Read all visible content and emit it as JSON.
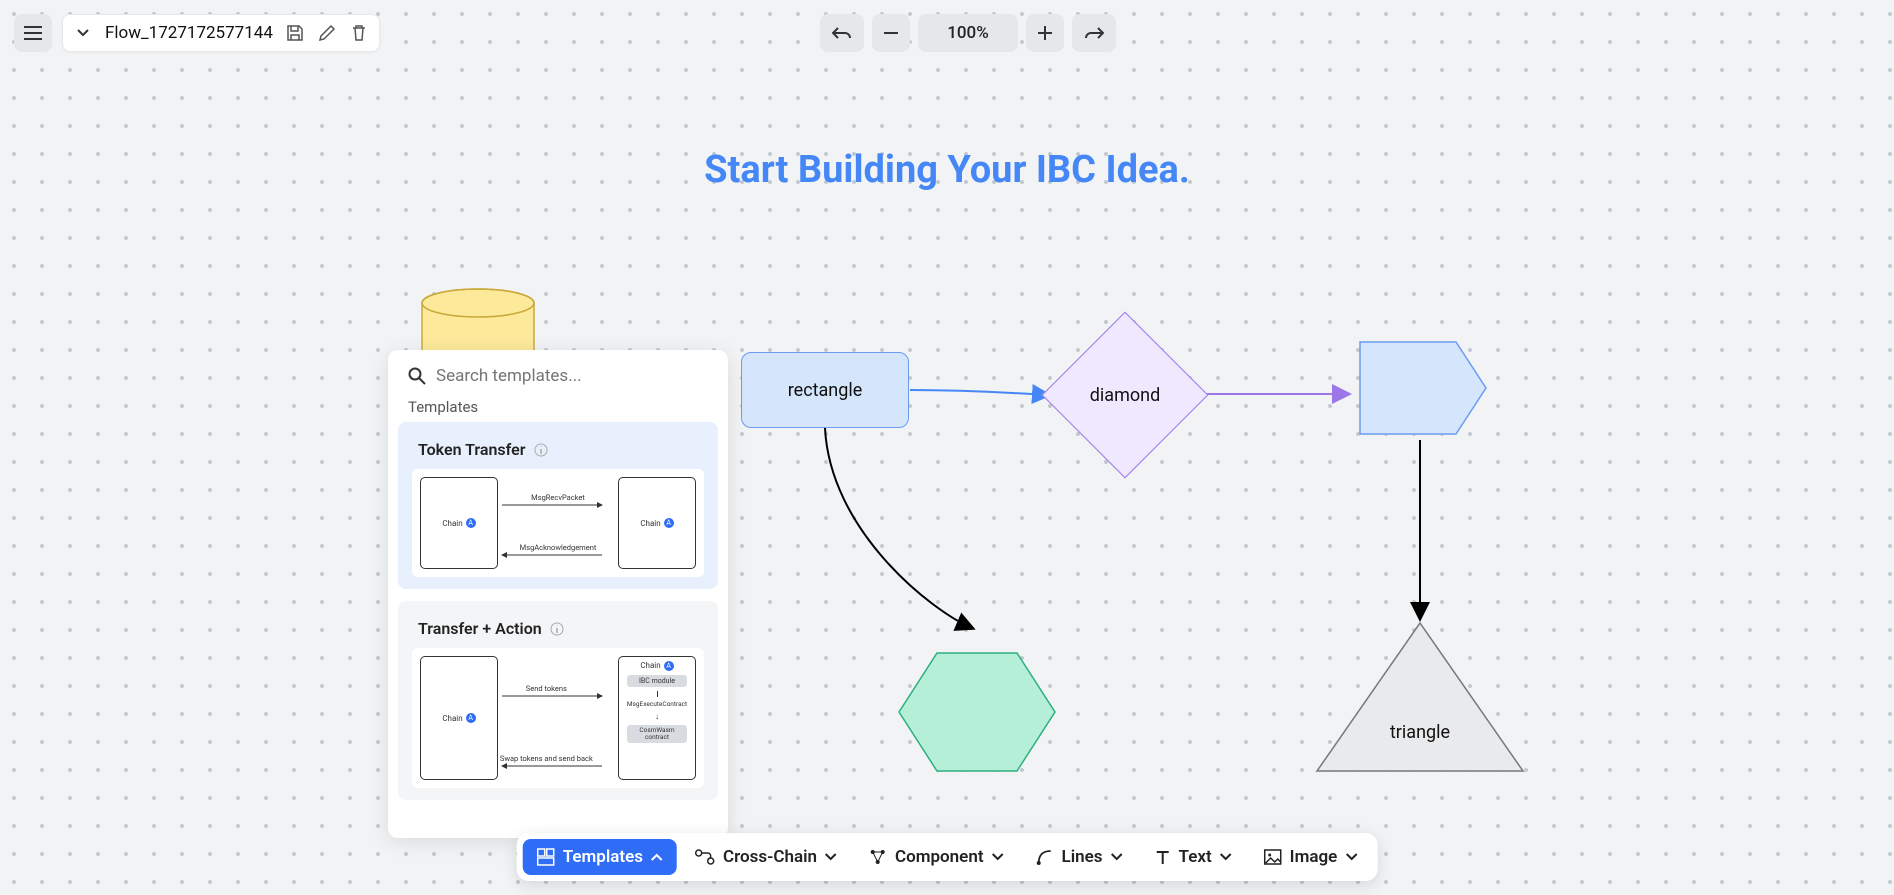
{
  "file": {
    "name": "Flow_1727172577144"
  },
  "zoom": {
    "level": "100%"
  },
  "canvas": {
    "title": "Start Building Your IBC Idea.",
    "shapes": {
      "rectangle": "rectangle",
      "diamond": "diamond",
      "arrow": "arrow",
      "hexagon": "hexagon",
      "triangle": "triangle"
    }
  },
  "templates": {
    "search_placeholder": "Search templates...",
    "section_label": "Templates",
    "cards": [
      {
        "title": "Token Transfer",
        "left_box": "Chain",
        "right_box": "Chain",
        "top_arrow_label": "MsgRecvPacket",
        "bottom_arrow_label": "MsgAcknowledgement",
        "chip_a": "A",
        "chip_b": "A"
      },
      {
        "title": "Transfer + Action",
        "left_box": "Chain",
        "right_chain": "Chain",
        "right_module": "IBC module",
        "right_msg": "MsgExecuteContract",
        "right_contract": "CosmWasm contract",
        "top_arrow_label": "Send tokens",
        "bottom_arrow_label": "Swap tokens and send back",
        "chip_a": "A",
        "chip_b": "A"
      }
    ]
  },
  "toolbar": {
    "templates": "Templates",
    "cross_chain": "Cross-Chain",
    "component": "Component",
    "lines": "Lines",
    "text": "Text",
    "image": "Image"
  }
}
